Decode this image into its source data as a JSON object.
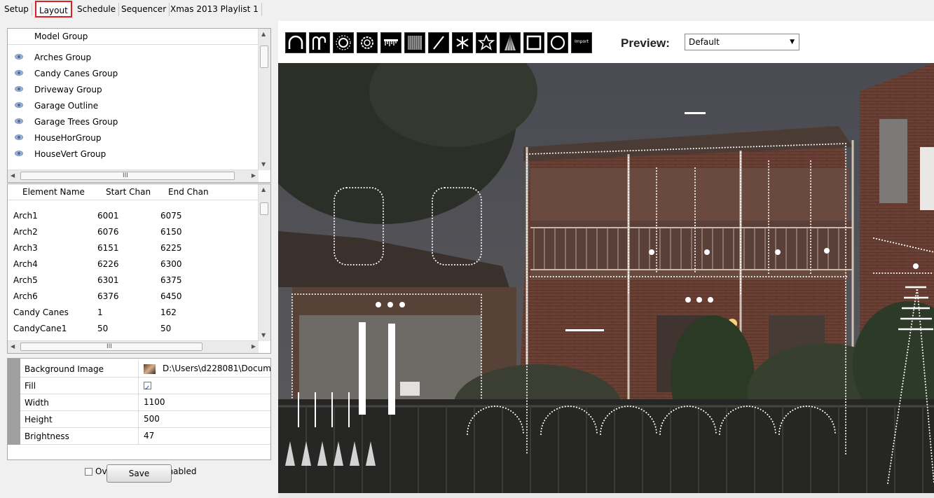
{
  "tabs": [
    "Setup",
    "Layout",
    "Schedule",
    "Sequencer",
    "Xmas 2013 Playlist 1"
  ],
  "active_tab": "Layout",
  "model_groups": {
    "header": "Model Group",
    "items": [
      "Arches Group",
      "Candy Canes Group",
      "Driveway Group",
      "Garage Outline",
      "Garage Trees Group",
      "HouseHorGroup",
      "HouseVert Group"
    ]
  },
  "elements": {
    "headers": [
      "Element Name",
      "Start Chan",
      "End Chan"
    ],
    "rows": [
      [
        "Arch1",
        "6001",
        "6075"
      ],
      [
        "Arch2",
        "6076",
        "6150"
      ],
      [
        "Arch3",
        "6151",
        "6225"
      ],
      [
        "Arch4",
        "6226",
        "6300"
      ],
      [
        "Arch5",
        "6301",
        "6375"
      ],
      [
        "Arch6",
        "6376",
        "6450"
      ],
      [
        "Candy Canes",
        "1",
        "162"
      ],
      [
        "CandyCane1",
        "50",
        "50"
      ]
    ]
  },
  "properties": {
    "background_image": {
      "label": "Background Image",
      "value": "D:\\Users\\d228081\\Docume"
    },
    "fill": {
      "label": "Fill",
      "checked": true
    },
    "width": {
      "label": "Width",
      "value": "1100"
    },
    "height": {
      "label": "Height",
      "value": "500"
    },
    "brightness": {
      "label": "Brightness",
      "value": "47"
    }
  },
  "overlap_checks": {
    "label": "Overlap checks enabled",
    "checked": false
  },
  "save_label": "Save",
  "toolbar": {
    "tools": [
      "arch-tool",
      "candy-cane-tool",
      "star-circle-tool",
      "wreath-tool",
      "icicles-tool",
      "matrix-tool",
      "single-line-tool",
      "snowflake-tool",
      "star-tool",
      "tree-tool",
      "window-frame-tool",
      "circle-tool",
      "import-tool"
    ],
    "import_label": "Import",
    "preview_label": "Preview:",
    "preview_value": "Default"
  },
  "scroll_glyph": "III"
}
